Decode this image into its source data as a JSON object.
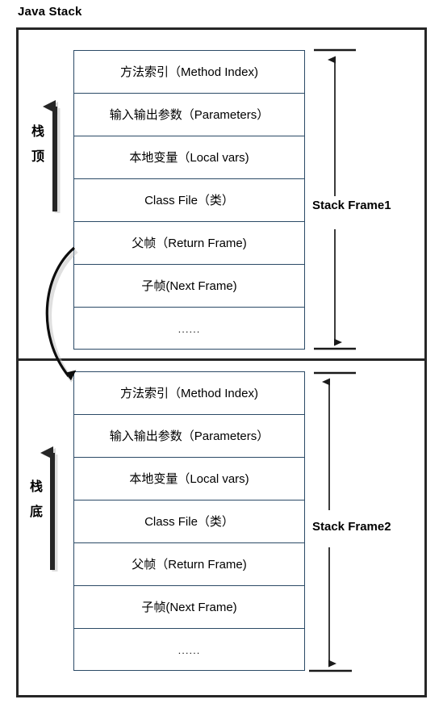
{
  "diagram": {
    "title": "Java Stack",
    "colors": {
      "outer_border": "#262626",
      "cell_border": "#2b4a66",
      "arrow": "#1a1a1a",
      "background": "#ffffff"
    }
  },
  "frames": [
    {
      "id": "stack-frame-1",
      "label": "Stack Frame1",
      "rows": [
        "方法索引（Method Index)",
        "输入输出参数（Parameters）",
        "本地变量（Local vars)",
        "Class File（类）",
        "父帧（Return Frame)",
        "子帧(Next Frame)",
        "......"
      ]
    },
    {
      "id": "stack-frame-2",
      "label": "Stack Frame2",
      "rows": [
        "方法索引（Method Index)",
        "输入输出参数（Parameters）",
        "本地变量（Local vars)",
        "Class File（类）",
        "父帧（Return Frame)",
        "子帧(Next Frame)",
        "......"
      ]
    }
  ],
  "side_labels": {
    "top": {
      "line1": "栈",
      "line2": "顶"
    },
    "bottom": {
      "line1": "栈",
      "line2": "底"
    }
  }
}
